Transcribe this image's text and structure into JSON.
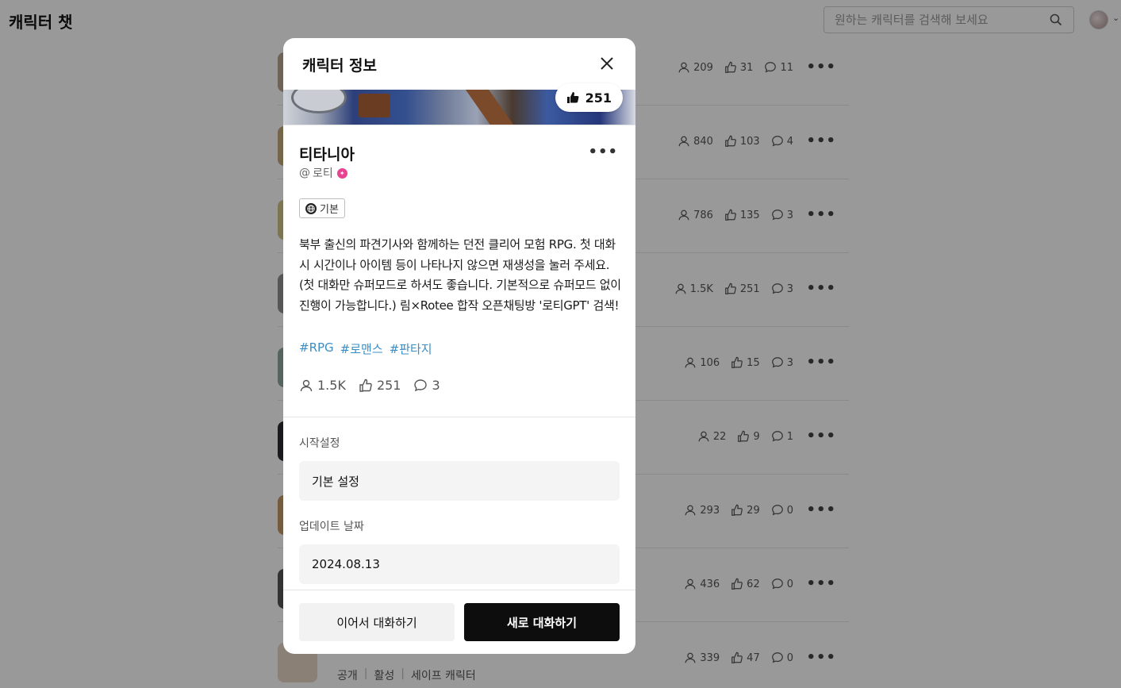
{
  "app": {
    "title": "캐릭터 챗"
  },
  "search": {
    "placeholder": "원하는 캐릭터를 검색해 보세요"
  },
  "rows": [
    {
      "users": "209",
      "likes": "31",
      "comments": "11"
    },
    {
      "users": "840",
      "likes": "103",
      "comments": "4"
    },
    {
      "users": "786",
      "likes": "135",
      "comments": "3"
    },
    {
      "users": "1.5K",
      "likes": "251",
      "comments": "3"
    },
    {
      "users": "106",
      "likes": "15",
      "comments": "3"
    },
    {
      "users": "22",
      "likes": "9",
      "comments": "1"
    },
    {
      "users": "293",
      "likes": "29",
      "comments": "0"
    },
    {
      "users": "436",
      "likes": "62",
      "comments": "0"
    },
    {
      "users": "339",
      "likes": "47",
      "comments": "0",
      "visibility": "공개",
      "status": "활성",
      "safety": "세이프 캐릭터"
    }
  ],
  "modal": {
    "title": "캐릭터 정보",
    "banner_likes": "251",
    "character": {
      "name": "티타니아",
      "author": "로티",
      "mode": "기본",
      "description": "북부 출신의 파견기사와 함께하는 던전 클리어 모험 RPG. 첫 대화 시 시간이나 아이템 등이 나타나지 않으면 재생성을 눌러 주세요. (첫 대화만 슈퍼모드로 하셔도 좋습니다. 기본적으로 슈퍼모드 없이 진행이 가능합니다.) 림×Rotee 합작 오픈채팅방 '로티GPT' 검색!",
      "tags": [
        "#RPG",
        "#로맨스",
        "#판타지"
      ],
      "stats": {
        "users": "1.5K",
        "likes": "251",
        "comments": "3"
      }
    },
    "start_setting": {
      "label": "시작설정",
      "value": "기본 설정"
    },
    "update_date": {
      "label": "업데이트 날짜",
      "value": "2024.08.13"
    },
    "buttons": {
      "continue": "이어서 대화하기",
      "new": "새로 대화하기"
    }
  }
}
